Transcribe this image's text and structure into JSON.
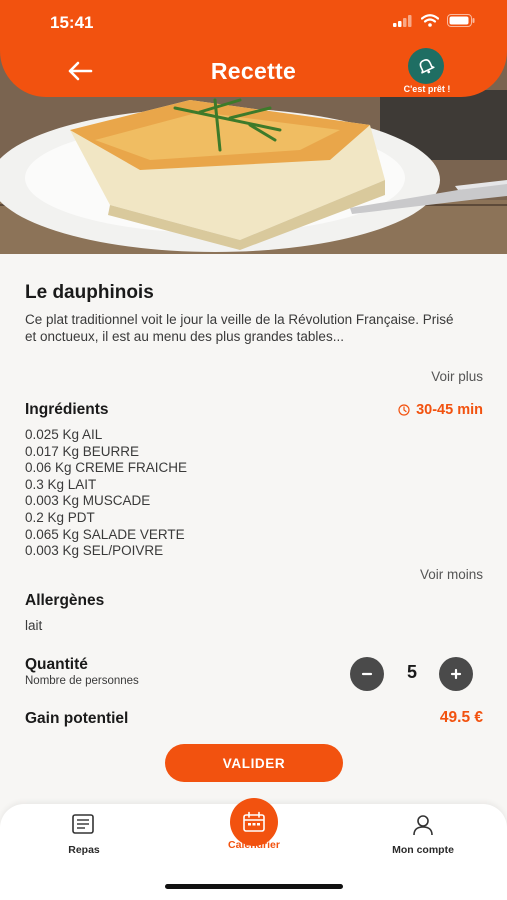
{
  "status_bar": {
    "time": "15:41"
  },
  "header": {
    "title": "Recette",
    "ready_label": "C'est prêt !"
  },
  "recipe": {
    "title": "Le dauphinois",
    "description": "Ce plat traditionnel voit le jour la veille de la Révolution Française. Prisé et onctueux, il est au menu des plus grandes tables...",
    "see_more": "Voir plus"
  },
  "ingredients": {
    "title": "Ingrédients",
    "duration": "30-45 min",
    "items": [
      "0.025 Kg AIL",
      "0.017 Kg BEURRE",
      "0.06 Kg CREME FRAICHE",
      "0.3 Kg LAIT",
      "0.003 Kg MUSCADE",
      "0.2 Kg PDT",
      "0.065 Kg SALADE VERTE",
      "0.003 Kg SEL/POIVRE"
    ],
    "see_less": "Voir moins"
  },
  "allergens": {
    "title": "Allergènes",
    "value": "lait"
  },
  "quantity": {
    "title": "Quantité",
    "subtitle": "Nombre de personnes",
    "value": "5"
  },
  "gain": {
    "title": "Gain potentiel",
    "value": "49.5 €"
  },
  "validate_label": "VALIDER",
  "tabs": [
    {
      "label": "Repas",
      "icon": "meals-icon"
    },
    {
      "label": "Calendrier",
      "icon": "calendar-icon",
      "active": true
    },
    {
      "label": "Mon compte",
      "icon": "user-icon"
    }
  ],
  "colors": {
    "accent": "#f2520f",
    "ready_button": "#1f6e63",
    "stepper": "#4a4a4a"
  }
}
